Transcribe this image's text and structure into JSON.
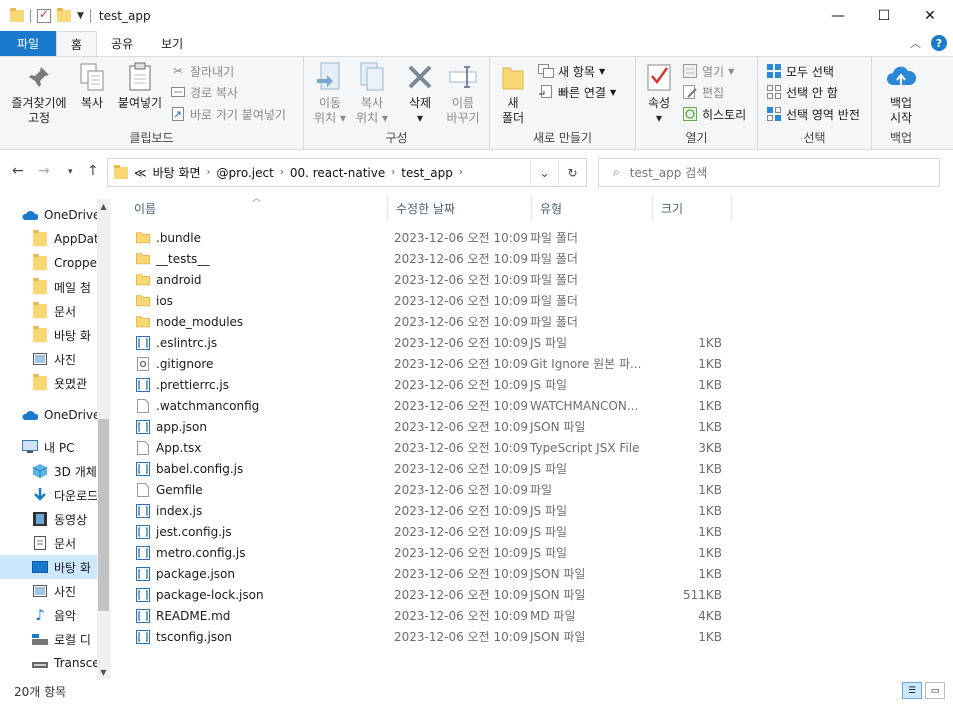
{
  "window": {
    "title": "test_app",
    "minimize": "—",
    "maximize": "☐",
    "close": "✕"
  },
  "tabs": [
    {
      "label": "파일"
    },
    {
      "label": "홈"
    },
    {
      "label": "공유"
    },
    {
      "label": "보기"
    }
  ],
  "ribbon": {
    "clipboard": {
      "label": "클립보드",
      "pin_line1": "즐겨찾기에",
      "pin_line2": "고정",
      "copy": "복사",
      "paste": "붙여넣기",
      "cut": "잘라내기",
      "copy_path": "경로 복사",
      "paste_shortcut": "바로 가기 붙여넣기"
    },
    "organize": {
      "label": "구성",
      "move_line1": "이동",
      "move_line2": "위치",
      "copyto_line1": "복사",
      "copyto_line2": "위치",
      "delete": "삭제",
      "rename_line1": "이름",
      "rename_line2": "바꾸기"
    },
    "new": {
      "label": "새로 만들기",
      "folder_line1": "새",
      "folder_line2": "폴더",
      "new_item": "새 항목",
      "easy_access": "빠른 연결"
    },
    "open": {
      "label": "열기",
      "properties": "속성",
      "open": "열기",
      "edit": "편집",
      "history": "히스토리"
    },
    "select": {
      "label": "선택",
      "select_all": "모두 선택",
      "select_none": "선택 안 함",
      "invert": "선택 영역 반전"
    },
    "backup": {
      "label": "백업",
      "start_line1": "백업",
      "start_line2": "시작"
    }
  },
  "address": {
    "crumbs": [
      "≪",
      "바탕 화면",
      "@pro.ject",
      "00. react-native",
      "test_app"
    ],
    "search_placeholder": "test_app 검색"
  },
  "nav_items": [
    {
      "label": "OneDrive"
    },
    {
      "label": "AppDat"
    },
    {
      "label": "Croppe"
    },
    {
      "label": "메일 첨"
    },
    {
      "label": "문서"
    },
    {
      "label": "바탕 화"
    },
    {
      "label": "사진"
    },
    {
      "label": "욧몄관"
    },
    {
      "label": "OneDrive"
    },
    {
      "label": "내 PC"
    },
    {
      "label": "3D 개체"
    },
    {
      "label": "다운로드"
    },
    {
      "label": "동영상"
    },
    {
      "label": "문서"
    },
    {
      "label": "바탕 화"
    },
    {
      "label": "사진"
    },
    {
      "label": "음악"
    },
    {
      "label": "로컬 디"
    },
    {
      "label": "Transce"
    }
  ],
  "columns": {
    "name": "이름",
    "date": "수정한 날짜",
    "type": "유형",
    "size": "크기"
  },
  "files": [
    {
      "name": ".bundle",
      "date": "2023-12-06 오전 10:09",
      "type": "파일 폴더",
      "size": "",
      "icon": "folder"
    },
    {
      "name": "__tests__",
      "date": "2023-12-06 오전 10:09",
      "type": "파일 폴더",
      "size": "",
      "icon": "folder"
    },
    {
      "name": "android",
      "date": "2023-12-06 오전 10:09",
      "type": "파일 폴더",
      "size": "",
      "icon": "folder"
    },
    {
      "name": "ios",
      "date": "2023-12-06 오전 10:09",
      "type": "파일 폴더",
      "size": "",
      "icon": "folder"
    },
    {
      "name": "node_modules",
      "date": "2023-12-06 오전 10:09",
      "type": "파일 폴더",
      "size": "",
      "icon": "folder"
    },
    {
      "name": ".eslintrc.js",
      "date": "2023-12-06 오전 10:09",
      "type": "JS 파일",
      "size": "1KB",
      "icon": "code"
    },
    {
      "name": ".gitignore",
      "date": "2023-12-06 오전 10:09",
      "type": "Git Ignore 원본 파...",
      "size": "1KB",
      "icon": "gear"
    },
    {
      "name": ".prettierrc.js",
      "date": "2023-12-06 오전 10:09",
      "type": "JS 파일",
      "size": "1KB",
      "icon": "code"
    },
    {
      "name": ".watchmanconfig",
      "date": "2023-12-06 오전 10:09",
      "type": "WATCHMANCON...",
      "size": "1KB",
      "icon": "doc"
    },
    {
      "name": "app.json",
      "date": "2023-12-06 오전 10:09",
      "type": "JSON 파일",
      "size": "1KB",
      "icon": "code"
    },
    {
      "name": "App.tsx",
      "date": "2023-12-06 오전 10:09",
      "type": "TypeScript JSX File",
      "size": "3KB",
      "icon": "doc"
    },
    {
      "name": "babel.config.js",
      "date": "2023-12-06 오전 10:09",
      "type": "JS 파일",
      "size": "1KB",
      "icon": "code"
    },
    {
      "name": "Gemfile",
      "date": "2023-12-06 오전 10:09",
      "type": "파일",
      "size": "1KB",
      "icon": "doc"
    },
    {
      "name": "index.js",
      "date": "2023-12-06 오전 10:09",
      "type": "JS 파일",
      "size": "1KB",
      "icon": "code"
    },
    {
      "name": "jest.config.js",
      "date": "2023-12-06 오전 10:09",
      "type": "JS 파일",
      "size": "1KB",
      "icon": "code"
    },
    {
      "name": "metro.config.js",
      "date": "2023-12-06 오전 10:09",
      "type": "JS 파일",
      "size": "1KB",
      "icon": "code"
    },
    {
      "name": "package.json",
      "date": "2023-12-06 오전 10:09",
      "type": "JSON 파일",
      "size": "1KB",
      "icon": "code"
    },
    {
      "name": "package-lock.json",
      "date": "2023-12-06 오전 10:09",
      "type": "JSON 파일",
      "size": "511KB",
      "icon": "code"
    },
    {
      "name": "README.md",
      "date": "2023-12-06 오전 10:09",
      "type": "MD 파일",
      "size": "4KB",
      "icon": "code"
    },
    {
      "name": "tsconfig.json",
      "date": "2023-12-06 오전 10:09",
      "type": "JSON 파일",
      "size": "1KB",
      "icon": "code"
    }
  ],
  "status": {
    "count": "20개 항목"
  },
  "colors": {
    "accent": "#1979ca",
    "folder": "#f8d775",
    "selected": "#cce8ff"
  }
}
